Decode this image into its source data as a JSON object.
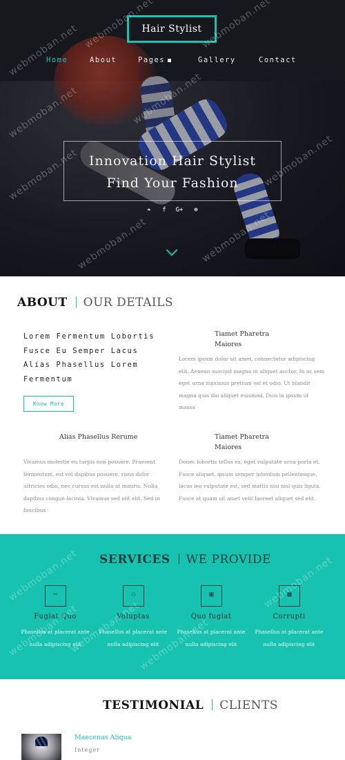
{
  "brand": {
    "logo": "Hair Stylist"
  },
  "nav": [
    {
      "label": "Home"
    },
    {
      "label": "About"
    },
    {
      "label": "Pages"
    },
    {
      "label": "Gallery"
    },
    {
      "label": "Contact"
    }
  ],
  "hero": {
    "line1": "Innovation Hair Stylist",
    "line2": "Find Your Fashion",
    "social": [
      "twitter-icon",
      "facebook-icon",
      "google-plus-icon",
      "dribbble-icon"
    ],
    "social_glyphs": [
      "❧",
      "f",
      "G+",
      "⊕"
    ]
  },
  "about": {
    "title": "ABOUT",
    "subtitle": "OUR DETAILS",
    "lead": "Lorem Fermentum Lobortis Fusce Eu Semper Lacus Alias Phasellus Lorem Fermentum",
    "button": "Know More",
    "blocks": [
      {
        "heading": "Tiamet Pharetra Maiores",
        "body": "Lorem ipsum dolor sit amet, connectetur adipiscing elit. Aenean suscipit magna in aliquet auctor. In ac sem eget urna maximus pretium vel et odio. Ut blandit magna quis dui aliquet euismod. Duis in ipsum ut massa"
      },
      {
        "heading": "Alias Phasellus Rerume",
        "body": "Vivamus molestie eu turpis non posuere. Praesent fermentum, est vel dapibus posuere, risus dolor ultricies odio, nec cursus est nulla at mauris. Nulla dapibus congue lacinia. Vivamus sed elit elit. Sed in faucibus"
      },
      {
        "heading": "Tiamet Pharetra Maiores",
        "body": "Donec lobortis tellus ex, eget vulputate urna porta et. Fusce aliquet, ipsum semper interdum pellentesque, lacus leo vulputate est, sed mattis nisi nisl quis ligula. Fusce at quam sit amet velit laoreet aliquet sed elit."
      }
    ]
  },
  "services": {
    "title": "SERVICES",
    "subtitle": "WE PROVIDE",
    "items": [
      {
        "name": "Fugiat Quo",
        "desc": "Phasellus at placerat ante nulla adipiscing elit",
        "icon": "✂"
      },
      {
        "name": "Voluptas",
        "desc": "Phasellus at placerat ante nulla adipiscing elit",
        "icon": "⚇"
      },
      {
        "name": "Quo fugiat",
        "desc": "Phasellus at placerat ante nulla adipiscing elit",
        "icon": "▣"
      },
      {
        "name": "Corrupti",
        "desc": "Phasellus at placerat ante nulla adipiscing elit",
        "icon": "▦"
      }
    ]
  },
  "testimonial": {
    "title": "TESTIMONIAL",
    "subtitle": "CLIENTS",
    "name": "Maecenas Aliqua",
    "role": "Integer"
  },
  "watermark": "webmoban.net",
  "colors": {
    "accent": "#17c2b0",
    "dark": "#1b1c22"
  }
}
